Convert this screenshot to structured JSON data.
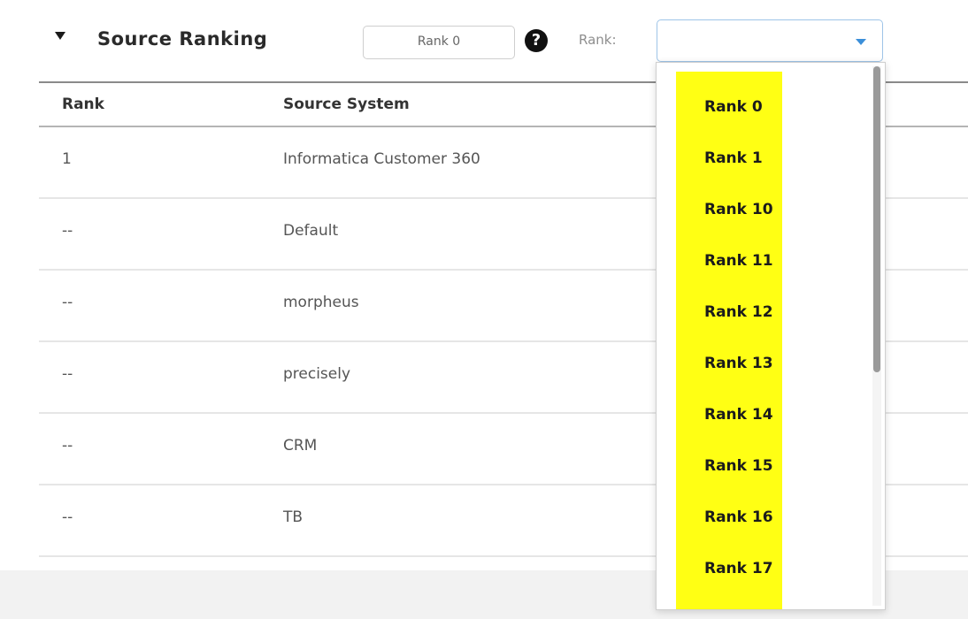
{
  "section": {
    "title": "Source Ranking",
    "rank_chip": "Rank 0",
    "help_symbol": "?",
    "rank_label": "Rank:",
    "select_value": ""
  },
  "table": {
    "headers": {
      "rank": "Rank",
      "source": "Source System"
    },
    "rows": [
      {
        "rank": "1",
        "source": "Informatica Customer 360"
      },
      {
        "rank": "--",
        "source": "Default"
      },
      {
        "rank": "--",
        "source": "morpheus"
      },
      {
        "rank": "--",
        "source": "precisely"
      },
      {
        "rank": "--",
        "source": "CRM"
      },
      {
        "rank": "--",
        "source": "TB"
      }
    ]
  },
  "dropdown": {
    "options": [
      "Rank 0",
      "Rank 1",
      "Rank 10",
      "Rank 11",
      "Rank 12",
      "Rank 13",
      "Rank 14",
      "Rank 15",
      "Rank 16",
      "Rank 17"
    ]
  },
  "colors": {
    "highlight": "#ffff14",
    "select_border": "#9ec4e8",
    "caret": "#3b8fd9"
  },
  "icons": {
    "collapse": "triangle-down-icon",
    "help": "question-circle-icon",
    "select_caret": "caret-down-icon"
  }
}
